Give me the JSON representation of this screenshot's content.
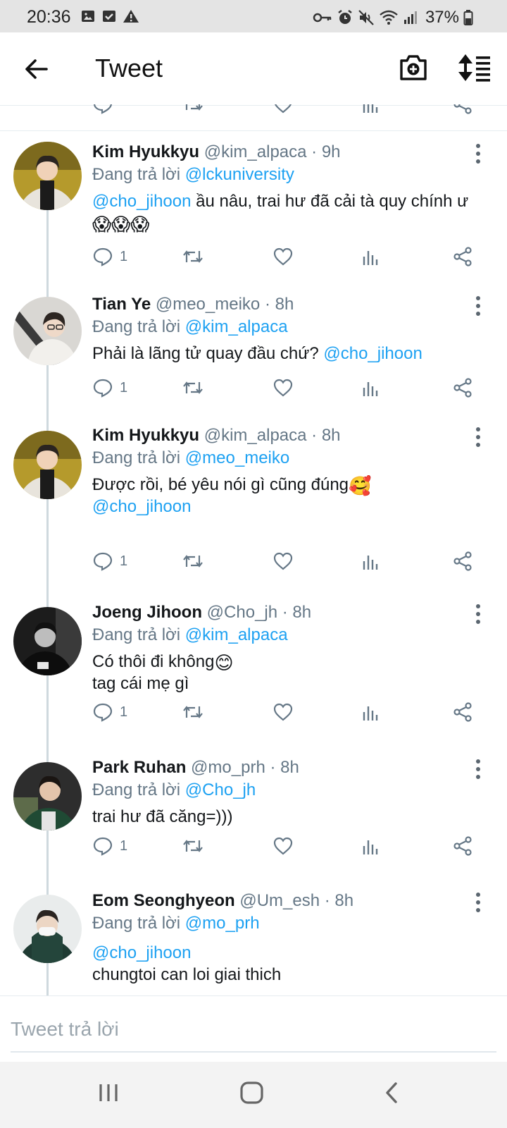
{
  "status_bar": {
    "time": "20:36",
    "battery": "37%"
  },
  "header": {
    "title": "Tweet"
  },
  "icons": {
    "back": "arrow-left-icon",
    "camera": "camera-plus-icon",
    "sort": "sort-list-icon",
    "reply": "speech-bubble-icon",
    "retweet": "retweet-icon",
    "like": "heart-icon",
    "stats": "bar-chart-icon",
    "share": "share-icon",
    "more": "vertical-dots-icon"
  },
  "colors": {
    "link": "#1da1f2",
    "muted": "#657786",
    "thread_line": "#cfd9de"
  },
  "tweets": [
    {
      "name": "Kim Hyukkyu",
      "handle": "@kim_alpaca",
      "time": "· 9h",
      "reply_label": "Đang trả lời",
      "reply_to": "@lckuniversity",
      "mention": "@cho_jihoon",
      "text": " ầu nâu, trai hư đã cải tà quy chính ư",
      "emoji": "😱😱😱",
      "reply_count": "1"
    },
    {
      "name": "Tian Ye",
      "handle": "@meo_meiko",
      "time": "· 8h",
      "reply_label": "Đang trả lời",
      "reply_to": "@kim_alpaca",
      "text": "Phải là lãng tử quay đầu chứ? ",
      "mention": "@cho_jihoon",
      "reply_count": "1"
    },
    {
      "name": "Kim Hyukkyu",
      "handle": "@kim_alpaca",
      "time": "· 8h",
      "reply_label": "Đang trả lời",
      "reply_to": "@meo_meiko",
      "text": "Được rồi, bé yêu nói gì cũng đúng",
      "emoji": "🥰",
      "mention": "@cho_jihoon",
      "reply_count": "1"
    },
    {
      "name": "Joeng Jihoon",
      "handle": "@Cho_jh",
      "time": "· 8h",
      "reply_label": "Đang trả lời",
      "reply_to": "@kim_alpaca",
      "text": "Có thôi đi không",
      "emoji": "😊",
      "text2": "tag cái mẹ gì",
      "reply_count": "1"
    },
    {
      "name": "Park Ruhan",
      "handle": "@mo_prh",
      "time": "· 8h",
      "reply_label": "Đang trả lời",
      "reply_to": "@Cho_jh",
      "text": "trai hư đã căng=)))",
      "reply_count": "1"
    },
    {
      "name": "Eom Seonghyeon",
      "handle": "@Um_esh",
      "time": "· 8h",
      "reply_label": "Đang trả lời",
      "reply_to": "@mo_prh",
      "mention": "@cho_jihoon",
      "text": "chungtoi can loi giai thich"
    }
  ],
  "reply_box": {
    "placeholder": "Tweet trả lời"
  },
  "nav": {
    "recents": "recents-icon",
    "home": "home-icon",
    "back": "back-chevron-icon"
  }
}
